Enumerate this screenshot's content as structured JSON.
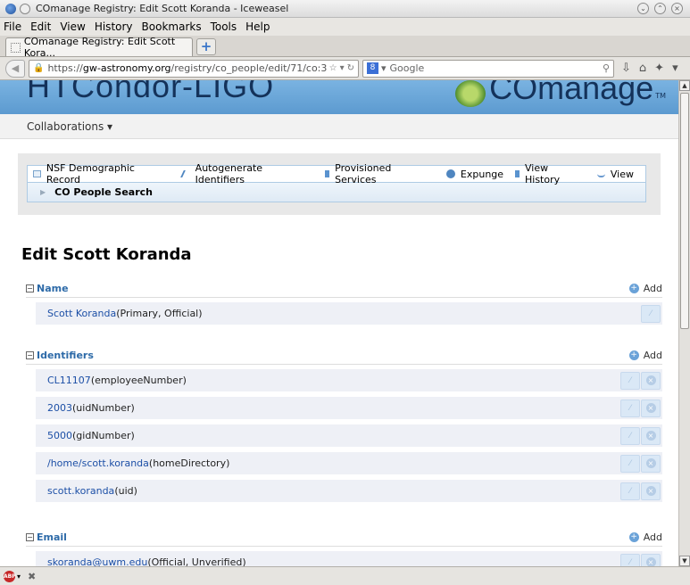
{
  "window": {
    "title": "COmanage Registry: Edit Scott Koranda - Iceweasel"
  },
  "menu": [
    "File",
    "Edit",
    "View",
    "History",
    "Bookmarks",
    "Tools",
    "Help"
  ],
  "tab": {
    "label": "COmanage Registry: Edit Scott Kora..."
  },
  "url": {
    "scheme": "https://",
    "host": "gw-astronomy.org",
    "path": "/registry/co_people/edit/71/co:3"
  },
  "search": {
    "placeholder": "Google"
  },
  "banner": {
    "site": "HTCondor-LIGO",
    "brand": "COmanage",
    "tm": "TM"
  },
  "collaborations_label": "Collaborations",
  "tools": [
    {
      "label": "NSF Demographic Record",
      "icon": "id-card-icon"
    },
    {
      "label": "Autogenerate Identifiers",
      "icon": "wand-icon"
    },
    {
      "label": "Provisioned Services",
      "icon": "list-icon"
    },
    {
      "label": "Expunge",
      "icon": "delete-icon"
    },
    {
      "label": "View History",
      "icon": "history-icon"
    },
    {
      "label": "View",
      "icon": "user-icon"
    }
  ],
  "people_search_label": "CO People Search",
  "page_title": "Edit Scott Koranda",
  "add_label": "Add",
  "name_section": {
    "title": "Name",
    "rows": [
      {
        "value": "Scott Koranda",
        "meta": "(Primary, Official)"
      }
    ]
  },
  "identifiers_section": {
    "title": "Identifiers",
    "rows": [
      {
        "value": "CL11107",
        "meta": "(employeeNumber)"
      },
      {
        "value": "2003",
        "meta": "(uidNumber)"
      },
      {
        "value": "5000",
        "meta": "(gidNumber)"
      },
      {
        "value": "/home/scott.koranda",
        "meta": "(homeDirectory)"
      },
      {
        "value": "scott.koranda",
        "meta": "(uid)"
      }
    ]
  },
  "email_section": {
    "title": "Email",
    "rows": [
      {
        "value": "skoranda@uwm.edu",
        "meta": "(Official, Unverified)"
      }
    ]
  }
}
